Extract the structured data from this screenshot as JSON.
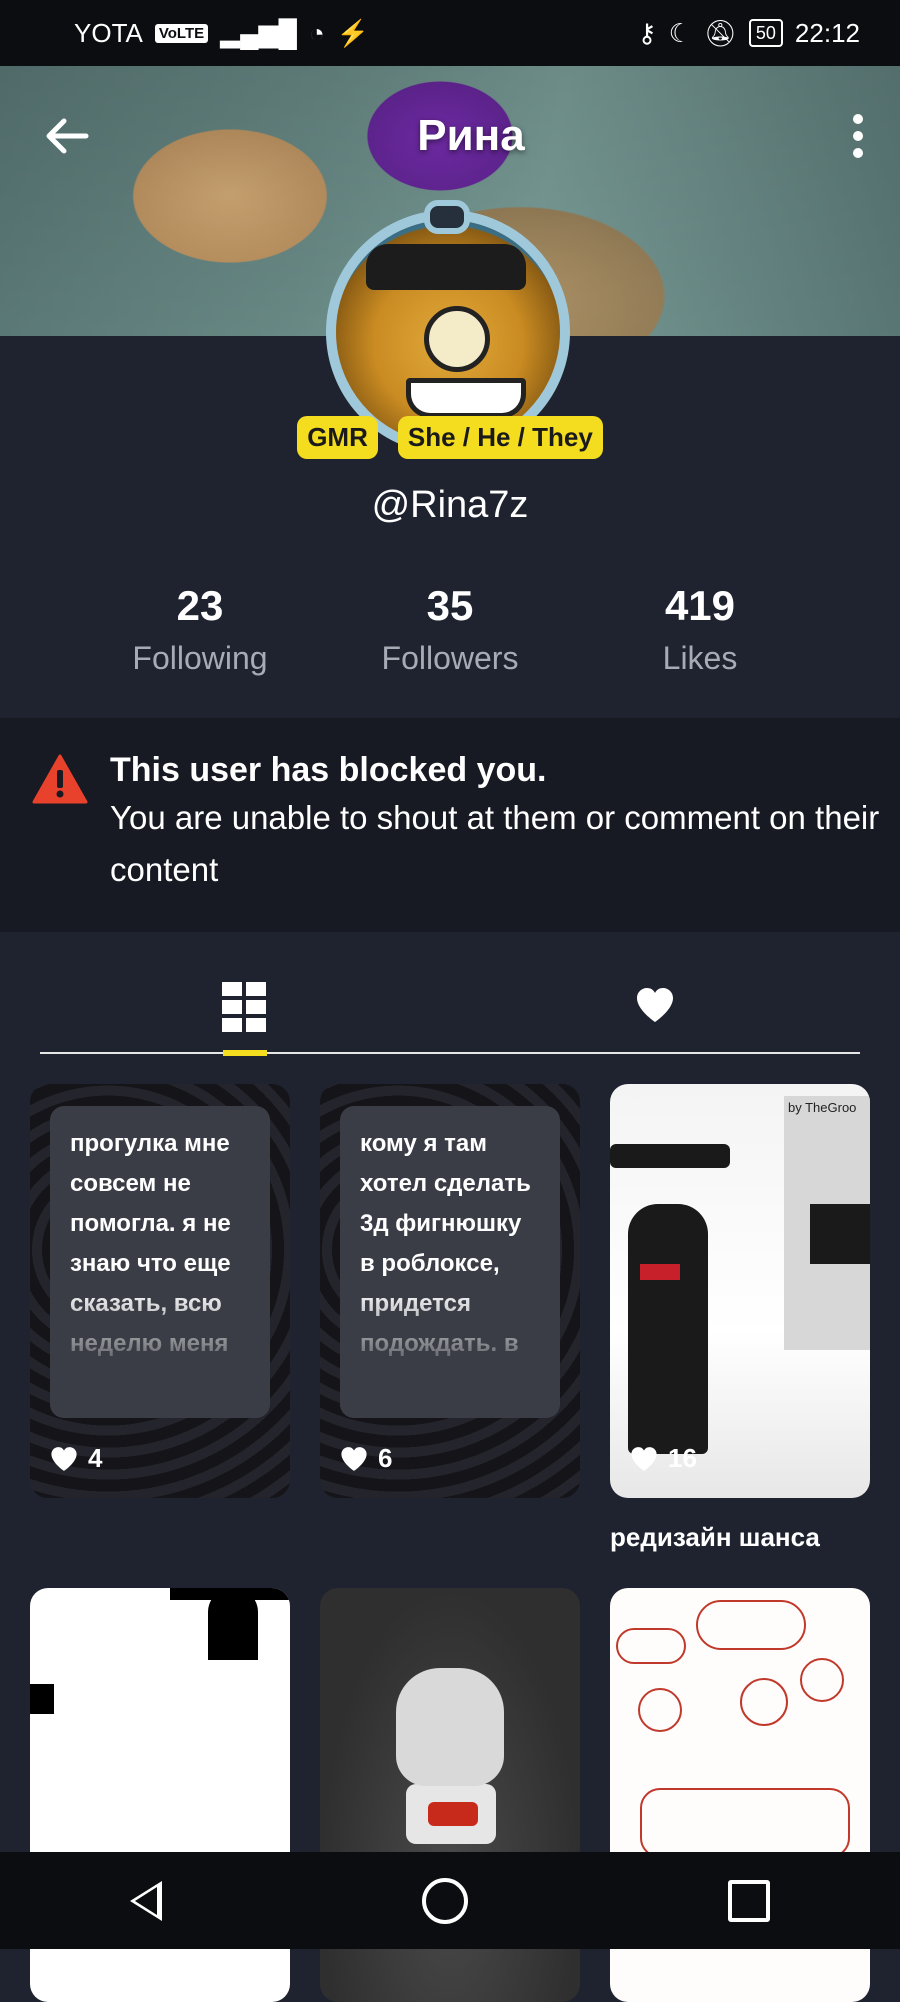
{
  "status_bar": {
    "carrier": "YOTA",
    "volte": "VoLTE",
    "battery": "50",
    "time": "22:12"
  },
  "header": {
    "title": "Рина"
  },
  "profile": {
    "badges": [
      "GMR",
      "She / He / They"
    ],
    "username": "@Rina7z",
    "stats": [
      {
        "value": "23",
        "label": "Following"
      },
      {
        "value": "35",
        "label": "Followers"
      },
      {
        "value": "419",
        "label": "Likes"
      }
    ]
  },
  "blocked_notice": {
    "title": "This user has blocked you.",
    "text": "You are unable to shout at them or comment on their content"
  },
  "tabs": {
    "active": "posts"
  },
  "posts": [
    {
      "type": "text",
      "text": "прогулка мне совсем не помогла. я не знаю что еще сказать, всю неделю меня",
      "likes": "4"
    },
    {
      "type": "text",
      "text": "кому я там хотел сделать 3д фигнюшку в роблоксе, придется подождать. в",
      "likes": "6"
    },
    {
      "type": "image",
      "likes": "16",
      "caption": "редизайн шанса",
      "signature": "by TheGroo"
    },
    {
      "type": "image"
    },
    {
      "type": "image"
    },
    {
      "type": "image"
    }
  ],
  "colors": {
    "background": "#1f232f",
    "accent": "#f4dc1e",
    "warning": "#e8412c"
  }
}
